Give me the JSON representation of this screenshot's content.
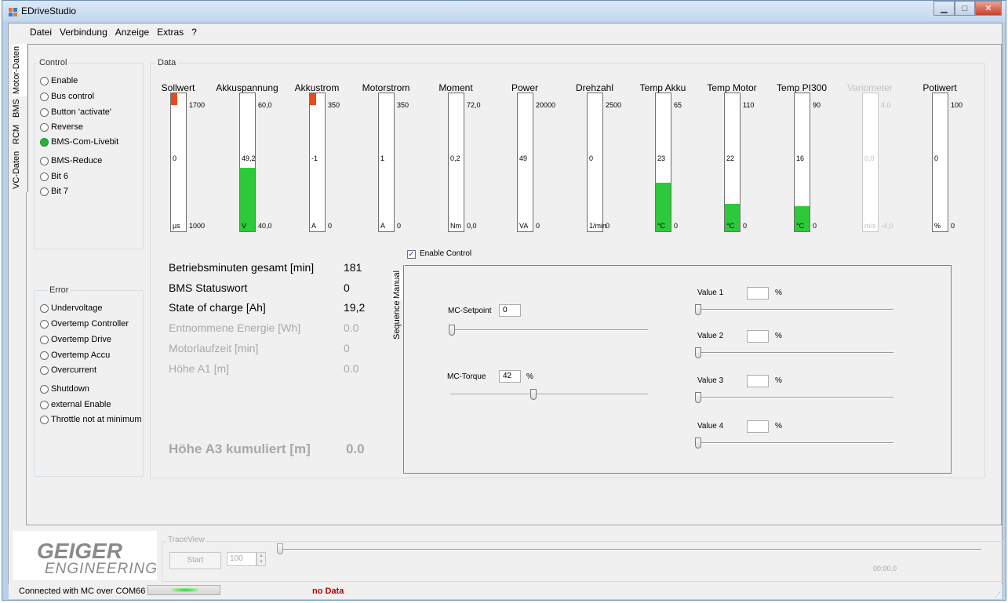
{
  "window": {
    "title": "EDriveStudio"
  },
  "menu": [
    "Datei",
    "Verbindung",
    "Anzeige",
    "Extras",
    "?"
  ],
  "vtabs": [
    "Motor-Daten",
    "BMS",
    "RCM",
    "VC-Daten"
  ],
  "control": {
    "title": "Control",
    "items": [
      {
        "label": "Enable",
        "on": false
      },
      {
        "label": "Bus control",
        "on": false
      },
      {
        "label": "Button 'activate'",
        "on": false
      },
      {
        "label": "Reverse",
        "on": false
      },
      {
        "label": "BMS-Com-Livebit",
        "on": true
      },
      {
        "label": "BMS-Reduce",
        "on": false
      },
      {
        "label": "Bit 6",
        "on": false
      },
      {
        "label": "Bit 7",
        "on": false
      }
    ]
  },
  "error": {
    "title": "Error",
    "items": [
      "Undervoltage",
      "Overtemp Controller",
      "Overtemp Drive",
      "Overtemp Accu",
      "Overcurrent",
      "Shutdown",
      "external Enable",
      "Throttle not at minimum"
    ]
  },
  "data_title": "Data",
  "gauges": [
    {
      "title": "Sollwert",
      "max": "1700",
      "value": "0",
      "unit": "µs",
      "min": "1000",
      "fill_fraction": 0,
      "red": true,
      "dim": false
    },
    {
      "title": "Akkuspannung",
      "max": "60,0",
      "value": "49,2",
      "unit": "V",
      "min": "40,0",
      "fill_fraction": 0.46,
      "red": false,
      "dim": false
    },
    {
      "title": "Akkustrom",
      "max": "350",
      "value": "-1",
      "unit": "A",
      "min": "0",
      "fill_fraction": 0,
      "red": true,
      "dim": false
    },
    {
      "title": "Motorstrom",
      "max": "350",
      "value": "1",
      "unit": "A",
      "min": "0",
      "fill_fraction": 0,
      "red": false,
      "dim": false
    },
    {
      "title": "Moment",
      "max": "72,0",
      "value": "0,2",
      "unit": "Nm",
      "min": "0,0",
      "fill_fraction": 0,
      "red": false,
      "dim": false
    },
    {
      "title": "Power",
      "max": "20000",
      "value": "49",
      "unit": "VA",
      "min": "0",
      "fill_fraction": 0,
      "red": false,
      "dim": false
    },
    {
      "title": "Drehzahl",
      "max": "2500",
      "value": "0",
      "unit": "1/min",
      "min": "0",
      "fill_fraction": 0,
      "red": false,
      "dim": false
    },
    {
      "title": "Temp Akku",
      "max": "65",
      "value": "23",
      "unit": "°C",
      "min": "0",
      "fill_fraction": 0.35,
      "red": false,
      "dim": false
    },
    {
      "title": "Temp Motor",
      "max": "110",
      "value": "22",
      "unit": "°C",
      "min": "0",
      "fill_fraction": 0.2,
      "red": false,
      "dim": false
    },
    {
      "title": "Temp PI300",
      "max": "90",
      "value": "16",
      "unit": "°C",
      "min": "0",
      "fill_fraction": 0.18,
      "red": false,
      "dim": false
    },
    {
      "title": "Variometer",
      "max": "4,0",
      "value": "0,0",
      "unit": "m/s",
      "min": "-4,0",
      "fill_fraction": 0,
      "red": false,
      "dim": true
    },
    {
      "title": "Potiwert",
      "max": "100",
      "value": "0",
      "unit": "%",
      "min": "0",
      "fill_fraction": 0,
      "red": false,
      "dim": false
    }
  ],
  "stats": [
    {
      "label": "Betriebsminuten gesamt [min]",
      "value": "181",
      "dim": false
    },
    {
      "label": "BMS Statuswort",
      "value": "0",
      "dim": false
    },
    {
      "label": "State of charge [Ah]",
      "value": "19,2",
      "dim": false
    },
    {
      "label": "Entnommene Energie [Wh]",
      "value": "0.0",
      "dim": true
    },
    {
      "label": "Motorlaufzeit [min]",
      "value": "0",
      "dim": true
    },
    {
      "label": "Höhe A1 [m]",
      "value": "0.0",
      "dim": true
    }
  ],
  "stat_big": {
    "label": "Höhe A3 kumuliert [m]",
    "value": "0.0"
  },
  "enable_control": {
    "label": "Enable Control",
    "checked": true
  },
  "panel_tabs": [
    "Manual",
    "Sequence"
  ],
  "manual": {
    "setpoint_label": "MC-Setpoint",
    "setpoint_value": "0",
    "torque_label": "MC-Torque",
    "torque_value": "42",
    "torque_unit": "%",
    "values": [
      {
        "label": "Value 1",
        "unit": "%"
      },
      {
        "label": "Value 2",
        "unit": "%"
      },
      {
        "label": "Value 3",
        "unit": "%"
      },
      {
        "label": "Value 4",
        "unit": "%"
      }
    ]
  },
  "trace": {
    "title": "TraceView",
    "start_label": "Start",
    "count": "100",
    "time": "00:00.0"
  },
  "logo": {
    "line1": "GEIGER",
    "line2": "ENGINEERING"
  },
  "status": {
    "connection": "Connected with MC over COM66",
    "data": "no Data"
  }
}
